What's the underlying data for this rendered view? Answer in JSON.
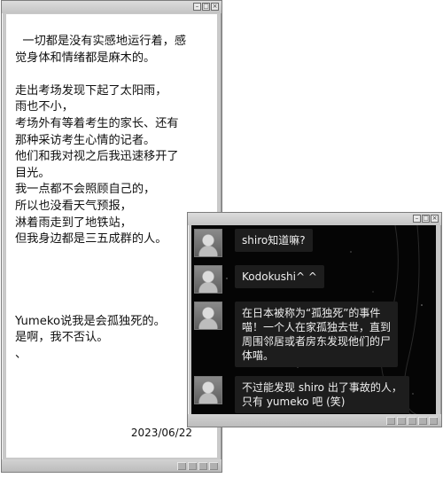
{
  "main_window": {
    "lines": [
      "  一切都是没有实感地运行着，感",
      "觉身体和情绪都是麻木的。",
      "",
      "走出考场发现下起了太阳雨，",
      "雨也不小，",
      "考场外有等着考生的家长、还有",
      "那种采访考生心情的记者。",
      "他们和我对视之后我迅速移开了",
      "目光。",
      "我一点都不会照顾自己的，",
      "所以也没看天气预报，",
      "淋着雨走到了地铁站，",
      "但我身边都是三五成群的人。"
    ],
    "lines2": [
      "Yumeko说我是会孤独死的。",
      "是啊，我不否认。",
      "、"
    ],
    "date": "2023/06/22"
  },
  "chat_window": {
    "messages": [
      {
        "lines": [
          "shiro知道嘛?"
        ]
      },
      {
        "lines": [
          "Kodokushi^ ^"
        ]
      },
      {
        "lines": [
          "在日本被称为“孤独死”的事件",
          "喵！一个人在家孤独去世，直到",
          "周围邻居或者房东发现他们的尸",
          "体喵。"
        ]
      },
      {
        "lines": [
          "不过能发现 shiro 出了事故的人，",
          "只有 yumeko 吧 (笑)"
        ]
      }
    ]
  },
  "icons": {
    "minimize": "minimize-icon",
    "maximize": "maximize-icon",
    "close": "close-icon"
  }
}
